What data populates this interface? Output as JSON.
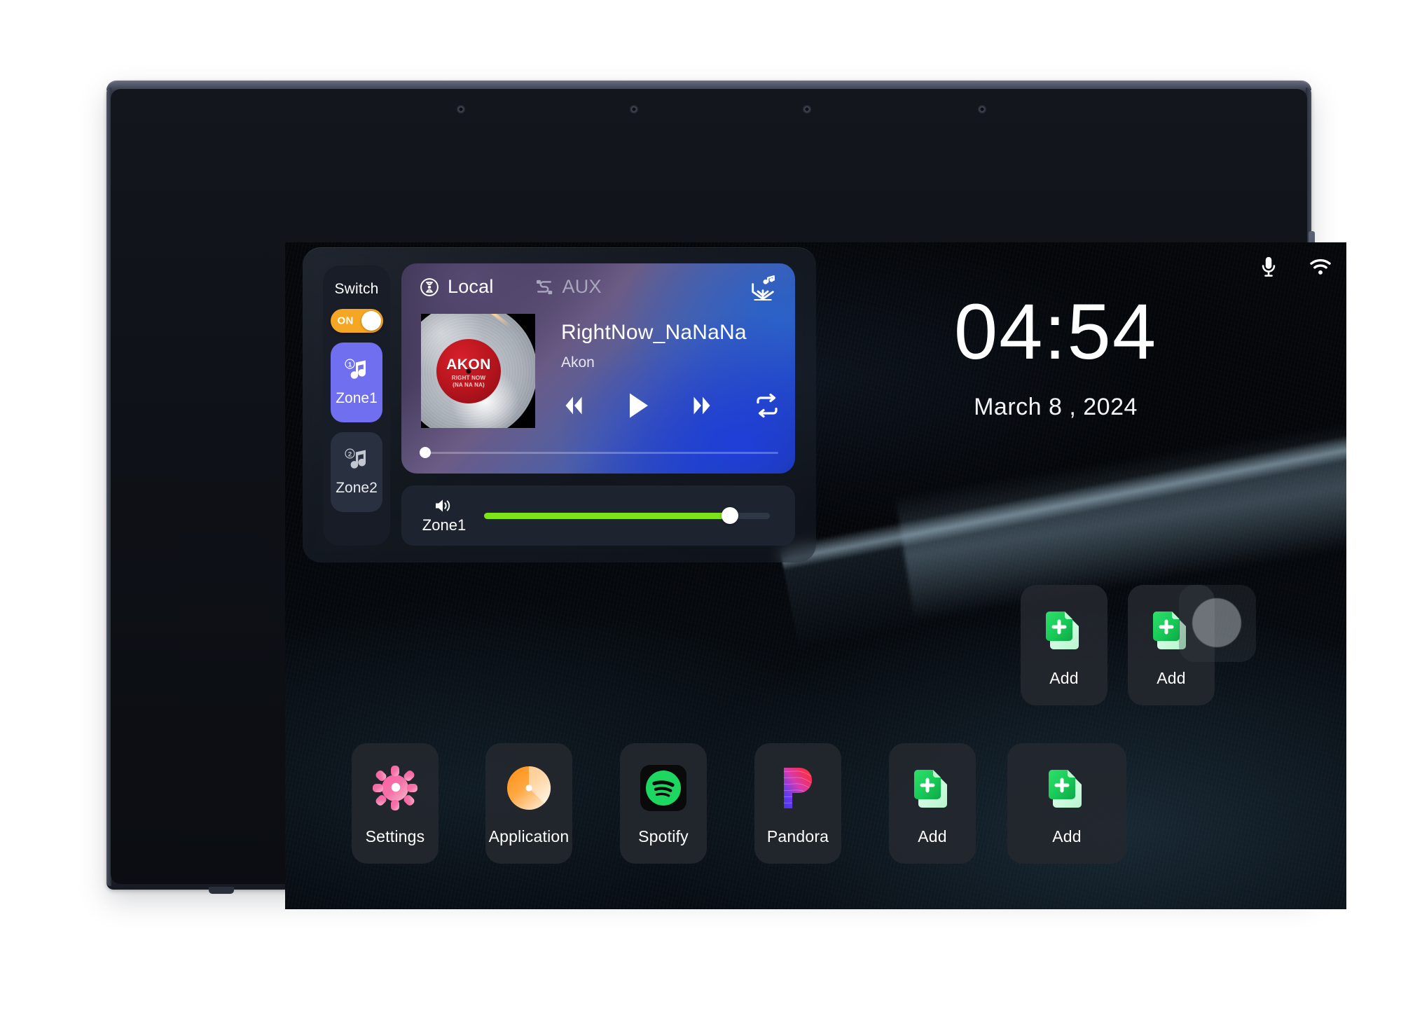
{
  "status_bar": {
    "mic_icon": "microphone-icon",
    "wifi_icon": "wifi-icon"
  },
  "clock": {
    "time": "04:54",
    "date": "March 8 , 2024"
  },
  "player": {
    "switch": {
      "label": "Switch",
      "toggle_state": "ON"
    },
    "zones": [
      {
        "label": "Zone1",
        "badge": "1",
        "icon": "music-note-icon",
        "active": true
      },
      {
        "label": "Zone2",
        "badge": "2",
        "icon": "music-note-icon",
        "active": false
      }
    ],
    "sources": [
      {
        "label": "Local",
        "icon": "local-source-icon",
        "active": true
      },
      {
        "label": "AUX",
        "icon": "aux-cable-icon",
        "active": false
      }
    ],
    "playlist_icon": "add-to-playlist-icon",
    "now_playing": {
      "title": "RightNow_NaNaNa",
      "artist": "Akon",
      "album_art_artist": "AKON",
      "album_art_subtitle": "RIGHT NOW\n(NA NA NA)",
      "progress_percent": 0
    },
    "controls": [
      {
        "name": "previous-button",
        "icon": "rewind-icon"
      },
      {
        "name": "play-button",
        "icon": "play-icon"
      },
      {
        "name": "next-button",
        "icon": "fast-forward-icon"
      },
      {
        "name": "repeat-button",
        "icon": "repeat-icon"
      }
    ],
    "volume": {
      "zone_label": "Zone1",
      "icon": "speaker-icon",
      "level_percent": 86
    }
  },
  "apps": {
    "top_row": [
      {
        "label": "Add",
        "icon": "add-app-icon"
      },
      {
        "label": "Add",
        "icon": "add-app-icon"
      }
    ],
    "dock": [
      {
        "label": "Settings",
        "icon": "gear-icon"
      },
      {
        "label": "Application",
        "icon": "application-icon"
      },
      {
        "label": "Spotify",
        "icon": "spotify-icon"
      },
      {
        "label": "Pandora",
        "icon": "pandora-icon"
      },
      {
        "label": "Add",
        "icon": "add-app-icon"
      },
      {
        "label": "Add",
        "icon": "add-app-icon"
      }
    ]
  },
  "colors": {
    "accent_zone_active": "#6f6ff0",
    "toggle_on": "#f5a623",
    "volume_fill": "#7ce417",
    "spotify_green": "#1ed760",
    "add_green": "#22d15e"
  }
}
